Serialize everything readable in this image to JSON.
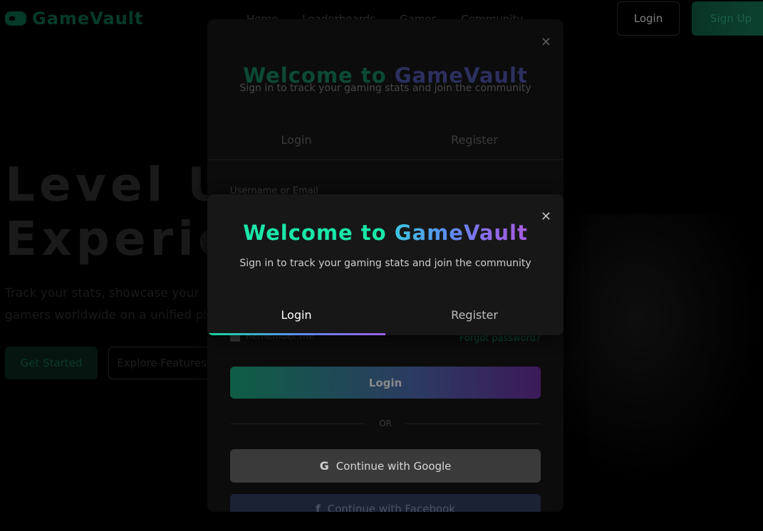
{
  "app": {
    "name": "GameVault"
  },
  "nav": {
    "items": [
      "Home",
      "Leaderboards",
      "Games",
      "Community"
    ]
  },
  "header": {
    "login_label": "Login",
    "signup_label": "Sign Up"
  },
  "hero": {
    "title_line1": "Level Up",
    "title_line2": "Experien",
    "subtitle_line1": "Track your stats, showcase your",
    "subtitle_line2": "gamers worldwide on a unified pl",
    "primary_cta": "Get Started",
    "secondary_cta": "Explore Features"
  },
  "modal_back": {
    "title_part1": "Welcome to",
    "title_part2": "GameVault",
    "subtitle": "Sign in to track your gaming stats and join the community",
    "tab_login": "Login",
    "tab_register": "Register",
    "field_label": "Username or Email",
    "remember_label": "Remember me",
    "forgot_label": "Forgot password?",
    "login_button": "Login",
    "divider_text": "OR",
    "google_button": "Continue with Google",
    "facebook_button": "Continue with Facebook"
  },
  "modal_front": {
    "title_part1": "Welcome to",
    "title_part2": "GameVault",
    "subtitle": "Sign in to track your gaming stats and join the community",
    "tab_login": "Login",
    "tab_register": "Register",
    "active_tab": "Login"
  },
  "colors": {
    "accent_green": "#1ae7a8",
    "accent_purple": "#9a5ee6",
    "accent_blue": "#5b8ef0",
    "modal_bg": "#171717",
    "page_bg": "#000000"
  },
  "icons": {
    "close": "close-icon",
    "google": "google-icon",
    "facebook": "facebook-icon",
    "logo": "gamepad-icon"
  }
}
